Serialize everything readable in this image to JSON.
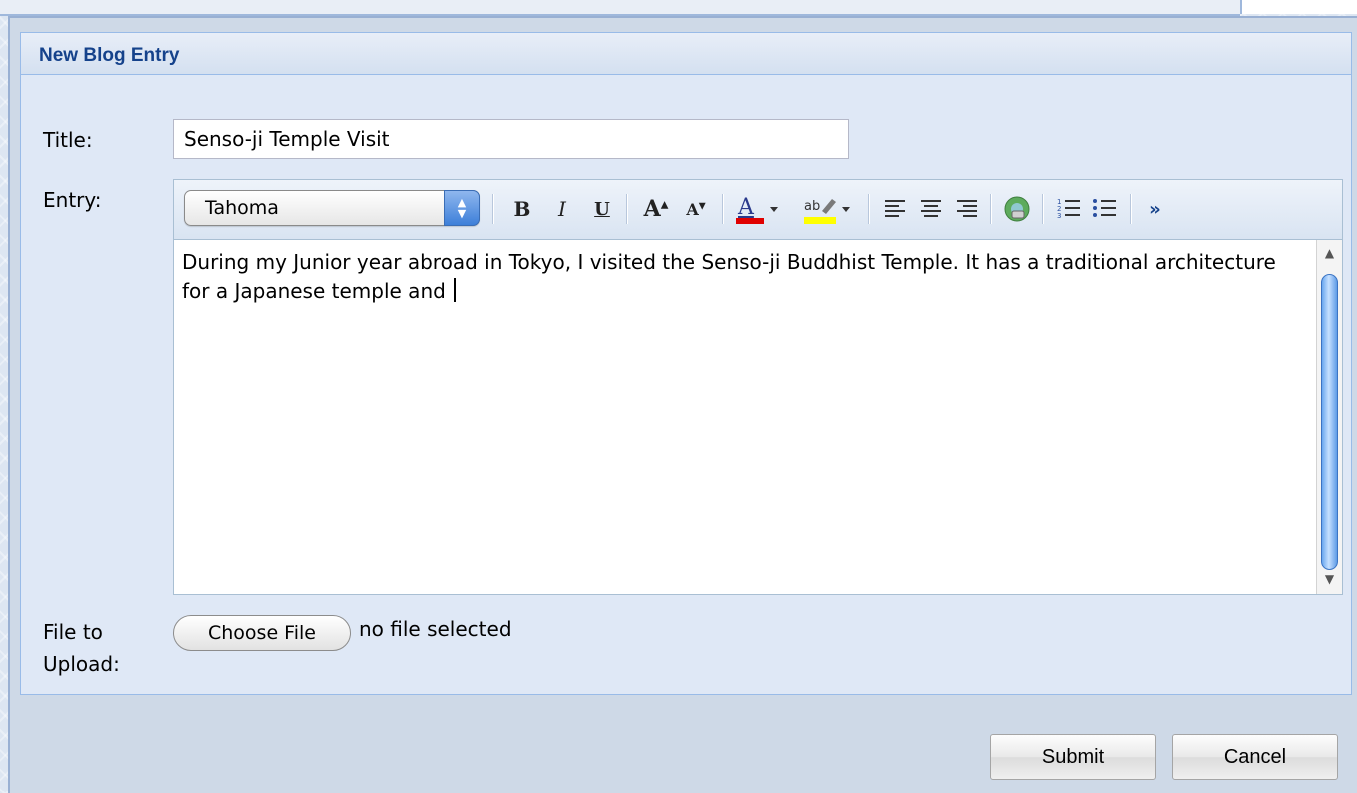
{
  "panel": {
    "title": "New Blog Entry"
  },
  "form": {
    "title_label": "Title:",
    "title_value": "Senso-ji Temple Visit",
    "entry_label": "Entry:",
    "file_label_line1": "File to",
    "file_label_line2": "Upload:"
  },
  "editor": {
    "font": "Tahoma",
    "toolbar": [
      "font-select",
      "bold-icon",
      "italic-icon",
      "underline-icon",
      "grow-text-icon",
      "shrink-text-icon",
      "font-color-icon",
      "highlight-color-icon",
      "align-left-icon",
      "align-center-icon",
      "align-right-icon",
      "insert-link-icon",
      "ordered-list-icon",
      "unordered-list-icon",
      "more-icon"
    ],
    "text": "During my Junior year abroad in Tokyo, I visited the Senso-ji Buddhist Temple. It has a traditional architecture for a Japanese temple and ",
    "colors": {
      "font_color": "#e00000",
      "highlight_color": "#ffff00"
    }
  },
  "upload": {
    "button_label": "Choose File",
    "status": "no file selected"
  },
  "buttons": {
    "submit": "Submit",
    "cancel": "Cancel"
  },
  "colors": {
    "header_text": "#15428b",
    "panel_bg": "#dfe8f6",
    "border": "#99bbe8"
  }
}
